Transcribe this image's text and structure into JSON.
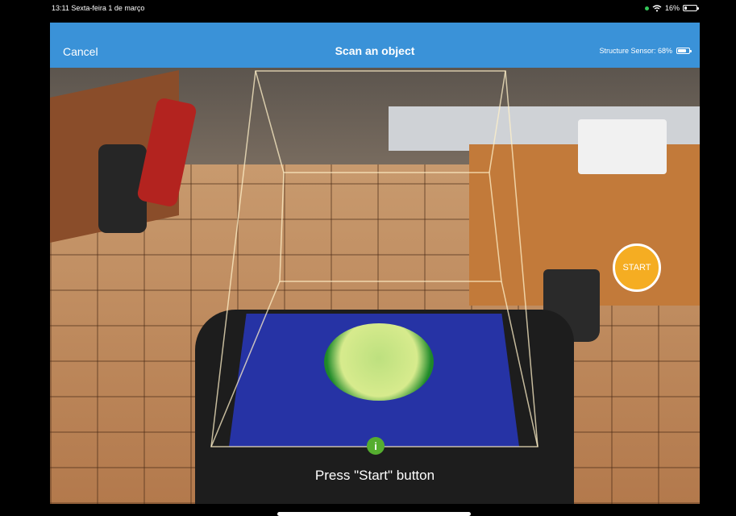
{
  "status_bar": {
    "time_date": "13:11  Sexta-feira 1 de março",
    "battery": "16%",
    "battery_level": 0.16
  },
  "nav": {
    "cancel_label": "Cancel",
    "title": "Scan an object",
    "sensor_label": "Structure Sensor: 68%",
    "sensor_level": 0.68
  },
  "controls": {
    "start_label": "START",
    "info_icon": "i"
  },
  "hint_text": "Press \"Start\" button",
  "colors": {
    "nav": "#3a92d8",
    "start": "#f5ad22",
    "info": "#55ad2f",
    "scan_surface": "#2633a5"
  }
}
